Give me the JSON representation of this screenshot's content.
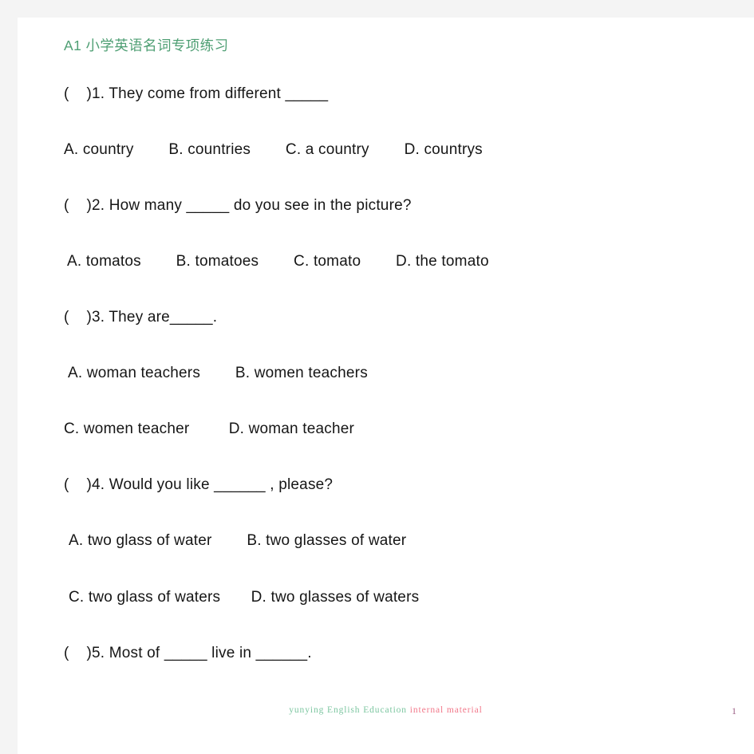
{
  "document": {
    "title": "A1 小学英语名词专项练习",
    "title_color": "#4f9f74",
    "page_background": "#ffffff",
    "canvas_background": "#f4f4f4"
  },
  "questions": [
    {
      "number": "1",
      "stem": "(    )1. They come from different _____",
      "option_lines": [
        "A. country        B. countries        C. a country        D. countrys"
      ]
    },
    {
      "number": "2",
      "stem": "(    )2. How many _____ do you see in the picture?",
      "option_lines": [
        "A. tomatos        B. tomatoes        C. tomato        D. the tomato"
      ]
    },
    {
      "number": "3",
      "stem": "(    )3. They are_____.",
      "option_lines": [
        "A. woman teachers        B. women teachers",
        "C. women teacher         D. woman teacher"
      ]
    },
    {
      "number": "4",
      "stem": "(    )4. Would you like ______ , please?",
      "option_lines": [
        "A. two glass of water        B. two glasses of water",
        "C. two glass of waters       D. two glasses of waters"
      ]
    },
    {
      "number": "5",
      "stem": "(    )5. Most of _____ live in ______.",
      "option_lines": []
    }
  ],
  "footer": {
    "text_green": "yunying English Education",
    "text_red": "internal material",
    "green_color": "#7cc6a0",
    "red_color": "#f2788a",
    "page_number": "1",
    "page_number_color": "#9b5f85"
  }
}
